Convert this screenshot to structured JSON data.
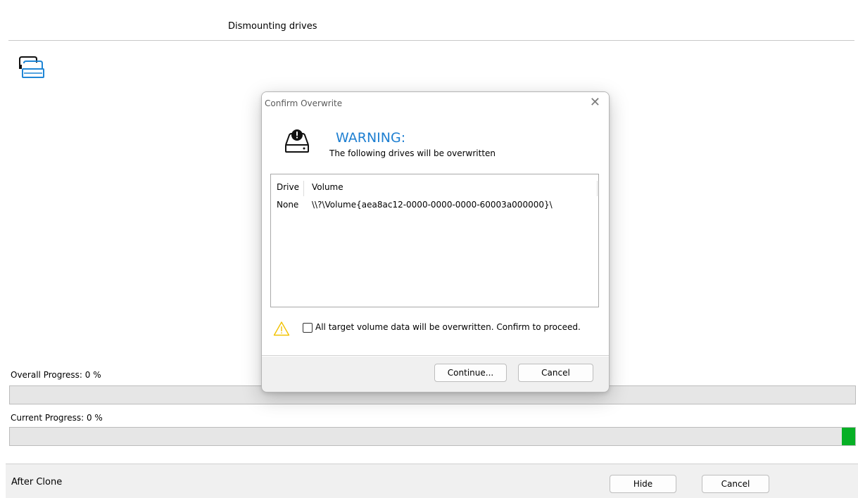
{
  "header": {
    "title": "Dismounting drives"
  },
  "icons": {
    "drive": "disk-drives-icon",
    "warning_drive": "drive-warning-icon",
    "caution": "caution-triangle-icon",
    "close": "close-icon"
  },
  "progress": {
    "overall_label": "Overall Progress:  0 %",
    "overall_value": 0,
    "current_label": "Current Progress:  0 %",
    "current_value": 0,
    "fill_color": "#06b025"
  },
  "footer": {
    "label": "After Clone",
    "hide_button": "Hide",
    "cancel_button": "Cancel"
  },
  "dialog": {
    "title": "Confirm Overwrite",
    "close_glyph": "✕",
    "warning_title": "WARNING:",
    "warning_subtitle": "The following drives will be overwritten",
    "table": {
      "columns": [
        "Drive",
        "Volume"
      ],
      "rows": [
        {
          "drive": "None",
          "volume": "\\\\?\\Volume{aea8ac12-0000-0000-0000-60003a000000}\\"
        }
      ]
    },
    "confirm_checkbox": {
      "label": "All target volume data will be overwritten. Confirm to proceed.",
      "checked": false
    },
    "continue_button": "Continue...",
    "cancel_button": "Cancel",
    "accent_color": "#1e7fd1",
    "caution_color": "#f2c200"
  }
}
